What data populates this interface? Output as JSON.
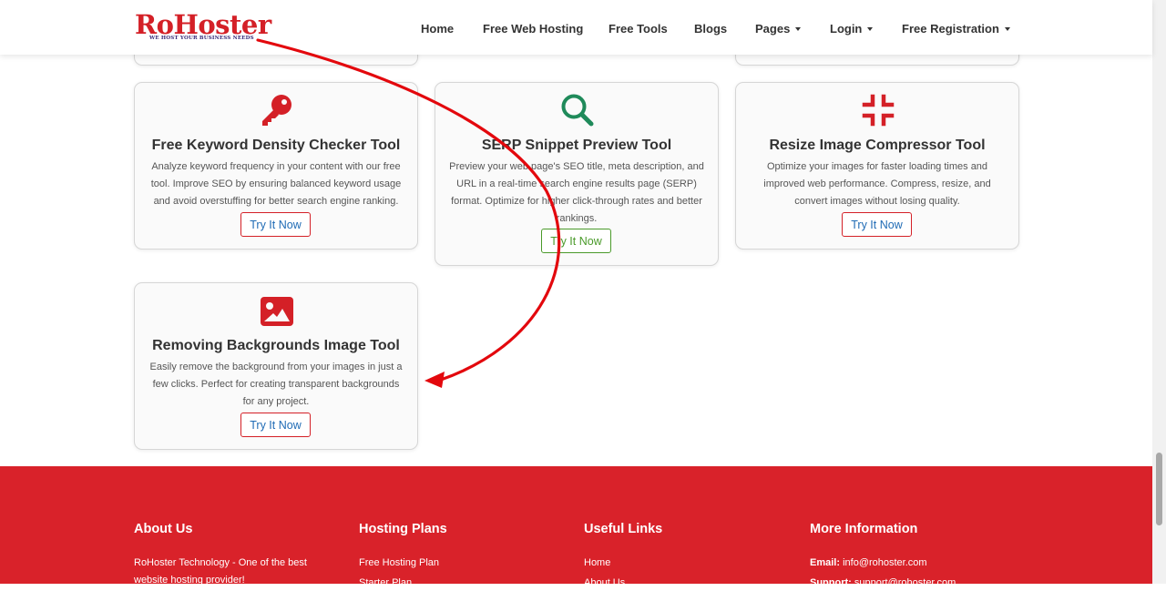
{
  "brand": {
    "name": "RoHoster",
    "tagline": "WE HOST YOUR BUSINESS NEEDS"
  },
  "nav": {
    "items": [
      "Home",
      "Free Web Hosting",
      "Free Tools",
      "Blogs",
      "Pages",
      "Login",
      "Free Registration"
    ]
  },
  "cards": [
    {
      "icon": "key-icon",
      "title": "Free Keyword Density Checker Tool",
      "description": "Analyze keyword frequency in your content with our free tool. Improve SEO by ensuring balanced keyword usage and avoid overstuffing for better search engine ranking.",
      "button": "Try It Now"
    },
    {
      "icon": "search-icon",
      "title": "SERP Snippet Preview Tool",
      "description": "Preview your web page's SEO title, meta description, and URL in a real-time search engine results page (SERP) format. Optimize for higher click-through rates and better rankings.",
      "button": "Try It Now"
    },
    {
      "icon": "compress-icon",
      "title": "Resize Image Compressor Tool",
      "description": "Optimize your images for faster loading times and improved web performance. Compress, resize, and convert images without losing quality.",
      "button": "Try It Now"
    },
    {
      "icon": "image-icon",
      "title": "Removing Backgrounds Image Tool",
      "description": "Easily remove the background from your images in just a few clicks. Perfect for creating transparent backgrounds for any project.",
      "button": "Try It Now"
    }
  ],
  "footer": {
    "about": {
      "heading": "About Us",
      "line1": "RoHoster Technology - One of the best",
      "line2": "website hosting provider!"
    },
    "hosting": {
      "heading": "Hosting Plans",
      "links": [
        "Free Hosting Plan",
        "Starter Plan"
      ]
    },
    "useful": {
      "heading": "Useful Links",
      "links": [
        "Home",
        "About Us"
      ]
    },
    "more": {
      "heading": "More Information",
      "email_label": "Email:",
      "email": "info@rohoster.com",
      "support_label": "Support:",
      "support": "support@rohoster.com"
    }
  },
  "colors": {
    "brand_red": "#d42027",
    "footer_red": "#d9222a",
    "icon_green": "#1f8a5a",
    "link_blue": "#1f6bb5",
    "button_green": "#4a9a2a",
    "annotation_red": "#e3080d"
  }
}
